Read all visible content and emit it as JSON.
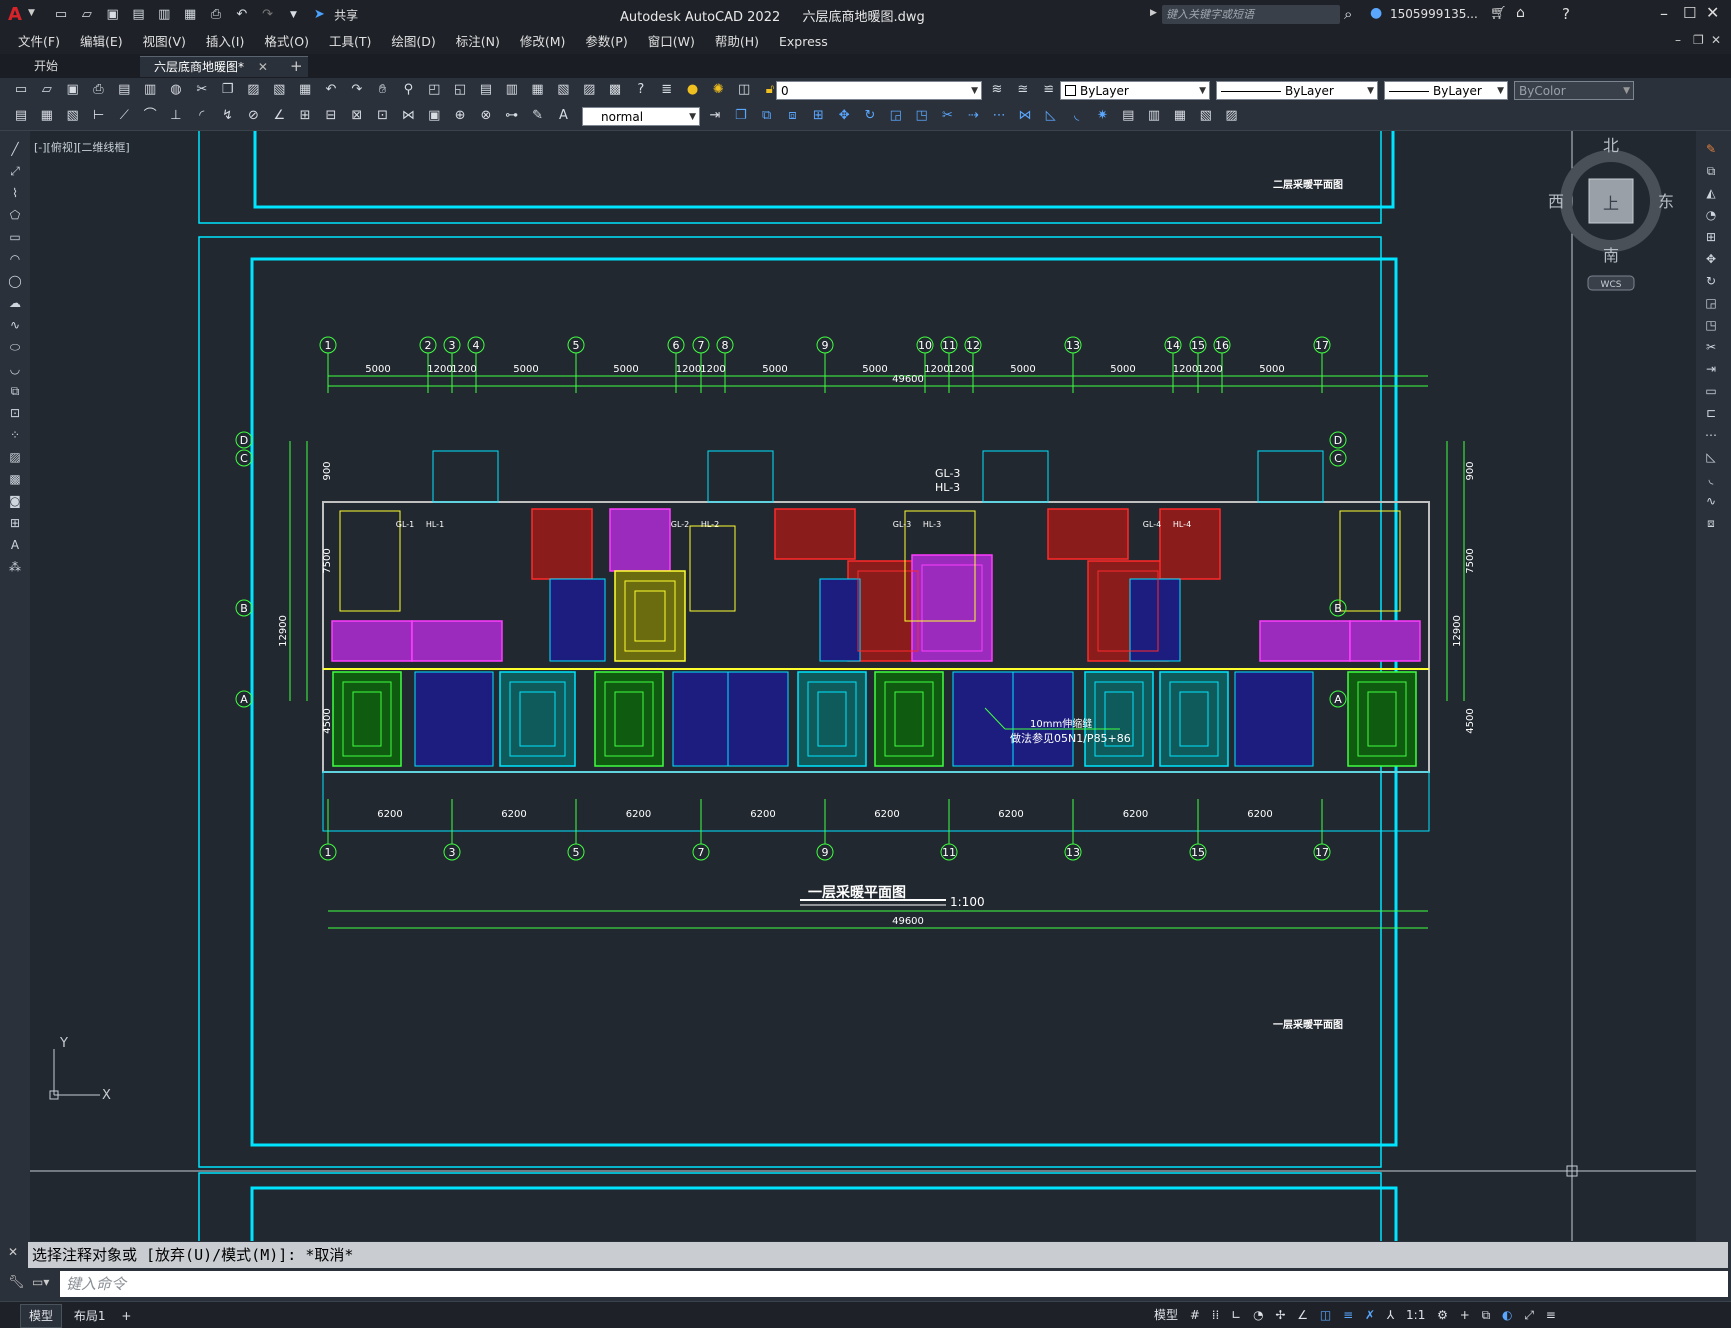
{
  "app": {
    "title": "Autodesk AutoCAD 2022",
    "file_name": "六层底商地暖图.dwg",
    "share_label": "共享",
    "search_placeholder": "键入关键字或短语",
    "user": "1505999135...",
    "accent": "#d8232a"
  },
  "menu": [
    "文件(F)",
    "编辑(E)",
    "视图(V)",
    "插入(I)",
    "格式(O)",
    "工具(T)",
    "绘图(D)",
    "标注(N)",
    "修改(M)",
    "参数(P)",
    "窗口(W)",
    "帮助(H)",
    "Express"
  ],
  "tabs": [
    {
      "label": "开始"
    },
    {
      "label": "六层底商地暖图*"
    }
  ],
  "toolbar": {
    "layer_value": "0",
    "color_value": "ByLayer",
    "linetype_value": "ByLayer",
    "lineweight_value": "ByLayer",
    "plotstyle_value": "ByColor",
    "dimstyle_value": "normal"
  },
  "viewport": {
    "label": "[-][俯视][二维线框]",
    "wcs_label": "WCS",
    "compass": {
      "north": "北",
      "south": "南",
      "east": "东",
      "west": "西",
      "center": "上"
    },
    "ucs_y": "Y",
    "ucs_x": "X"
  },
  "drawing": {
    "upper_sheet_title": "二层采暖平面图",
    "sheet_title_small": "一层采暖平面图",
    "main_title": "一层采暖平面图",
    "main_scale": "1:100",
    "note_line1": "10mm伸缩缝",
    "note_line2": "做法参见05N1/P85+86",
    "top_axes": [
      "1",
      "2",
      "3",
      "4",
      "5",
      "6",
      "7",
      "8",
      "9",
      "10",
      "11",
      "12",
      "13",
      "14",
      "15",
      "16",
      "17"
    ],
    "top_dims": [
      "5000",
      "1200",
      "1200",
      "5000",
      "5000",
      "1200",
      "1200",
      "5000",
      "5000",
      "1200",
      "1200",
      "5000",
      "5000",
      "1200",
      "1200",
      "5000"
    ],
    "top_total": "49600",
    "bottom_axes": [
      "1",
      "3",
      "5",
      "7",
      "9",
      "11",
      "13",
      "15",
      "17"
    ],
    "bottom_dims": [
      "6200",
      "6200",
      "6200",
      "6200",
      "6200",
      "6200",
      "6200",
      "6200"
    ],
    "bottom_total": "49600",
    "row_axes": [
      "D",
      "C",
      "B",
      "A"
    ],
    "side_dims": [
      "900",
      "7500",
      "4500"
    ],
    "side_total": "12900",
    "riser_labels": [
      "GL-1",
      "HL-1",
      "GL-2",
      "HL-2",
      "GL-3",
      "HL-3",
      "GL-4",
      "HL-4"
    ],
    "riser_top_labels": [
      "GL-3",
      "HL-3"
    ]
  },
  "command": {
    "history": "选择注释对象或 [放弃(U)/模式(M)]: *取消*",
    "placeholder": "键入命令"
  },
  "status": {
    "layout_tabs": [
      "模型",
      "布局1"
    ],
    "model_label": "模型",
    "scale": "1:1"
  }
}
